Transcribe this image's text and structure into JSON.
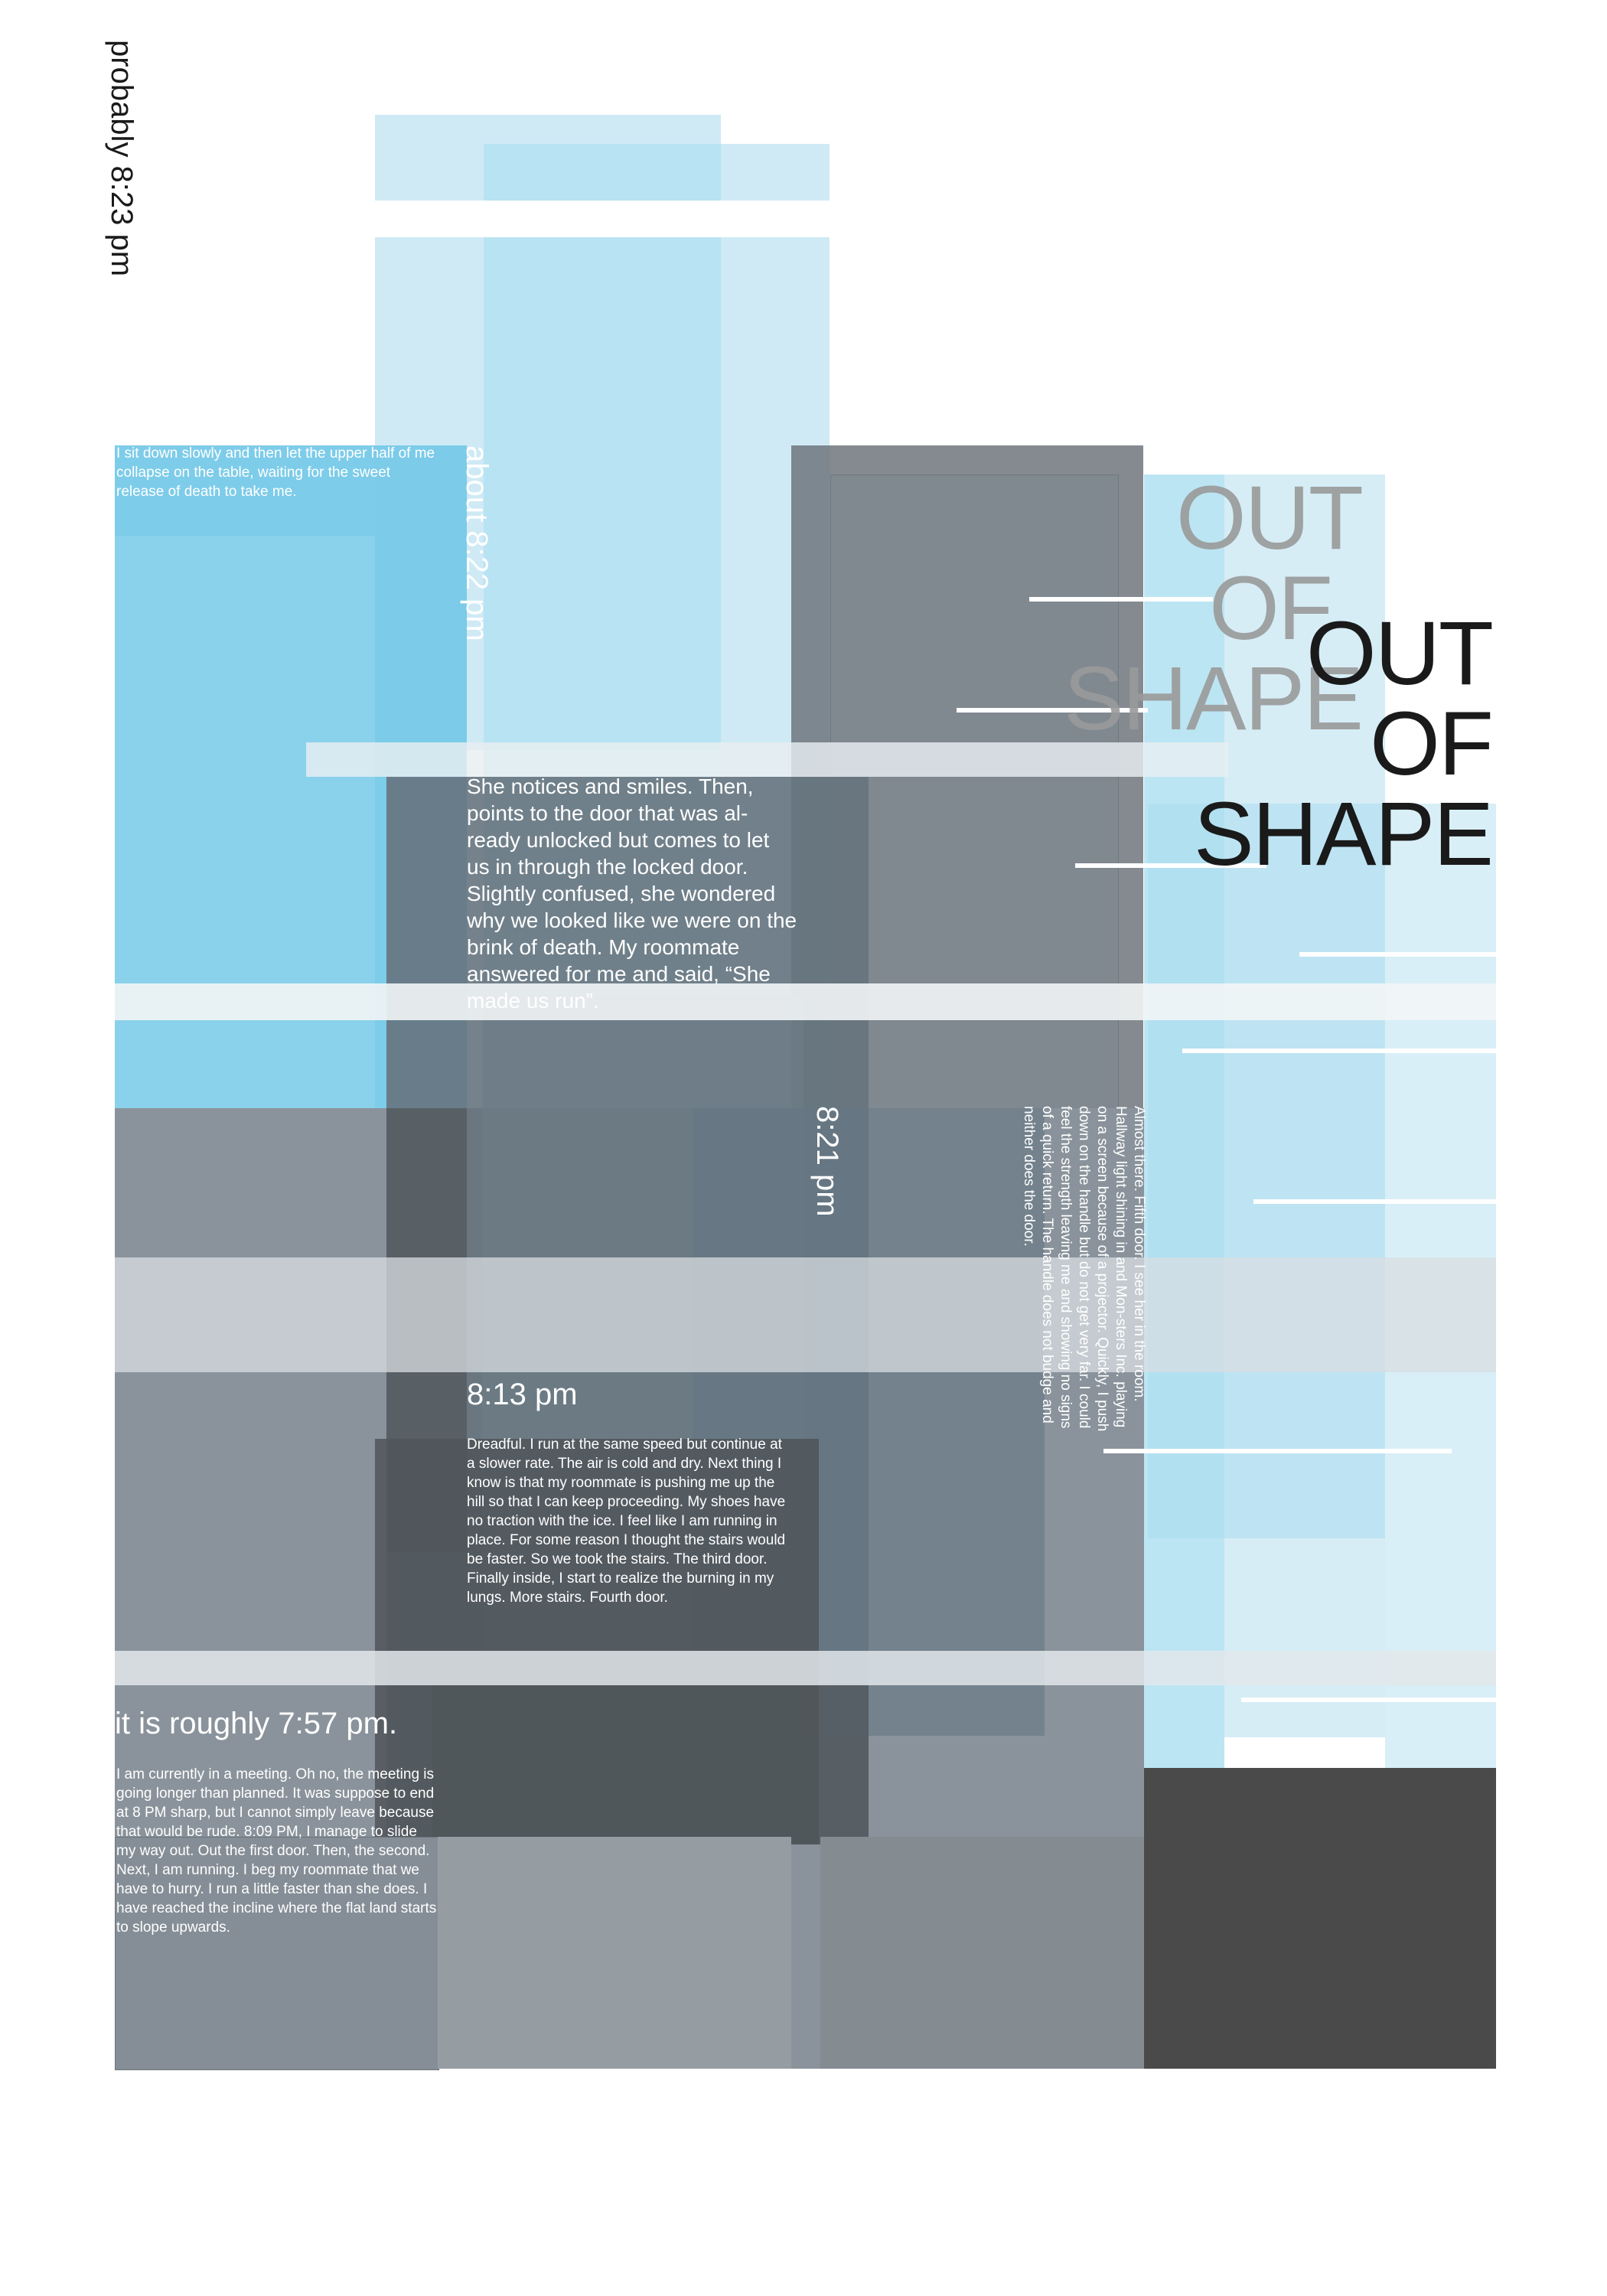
{
  "poster": {
    "timestamps": {
      "t1": "probably 8:23 pm",
      "t2": "about 8:22 pm",
      "t3": "8:21 pm",
      "t4": "8:13 pm",
      "t5": "it is roughly 7:57 pm."
    },
    "paragraphs": {
      "p_823": "I sit down slowly and then let the upper half of me collapse on the table, waiting for the sweet release of death to take me.",
      "p_822": "She notices and smiles. Then, points to the door that was al-ready unlocked but comes to let us in through the locked door. Slightly confused, she wondered why we looked like we were on the brink of death. My roommate answered for me and said, “She made us run”.",
      "p_821": "Almost there. Fifth door. I see her in the room. Hallway light shining in and Mon-sters Inc. playing on a screen because of a projector. Quickly, I push down on the handle but do not get very far. I could feel the strength leaving me and showing no signs of a quick return. The handle does not budge and neither does the door.",
      "p_813": " Dreadful. I run at the same speed but continue at a slower rate. The air is cold and dry. Next thing I know is that my roommate is pushing me up the hill so that I can keep proceeding. My shoes have no traction with the ice. I feel like I am running in place. For some reason I thought the stairs would be faster. So we took the stairs. The third door. Finally inside, I start to realize the burning in my lungs. More stairs. Fourth door.",
      "p_757": "I am currently in a meeting. Oh no, the meeting is going longer than planned. It was suppose to end at 8 PM sharp, but I cannot simply leave because that would be rude. 8:09 PM, I manage to slide my way out. Out the first door. Then, the second. Next, I am running. I beg my roommate that we have to hurry. I run a little faster than she does. I have reached the incline where the flat land starts to slope upwards."
    },
    "title_ghost": {
      "line1": "OUT",
      "line2": "OF",
      "line3": "SHAPE"
    },
    "title_main": {
      "line1": "OUT",
      "line2": "OF",
      "line3": "SHAPE"
    },
    "colors": {
      "light_blue": "#cfeaf5",
      "blue": "#a6dcef",
      "strong_blue": "#76c9e8",
      "gray": "#7d8790",
      "slate": "#6a7a85",
      "dark": "#4a4a4a",
      "text_dark": "#1a1a1a",
      "ghost_gray": "#9a9a9a"
    }
  }
}
